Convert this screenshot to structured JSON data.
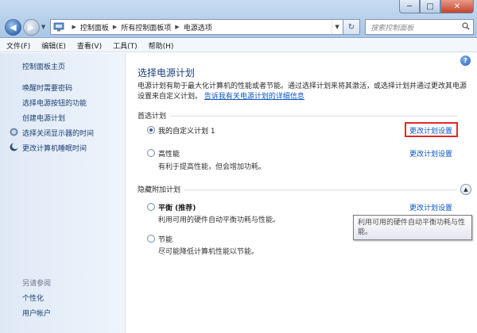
{
  "window": {
    "caption_min": "─",
    "caption_max": "□",
    "caption_close": "✕"
  },
  "address": {
    "crumbs": [
      "控制面板",
      "所有控制面板项",
      "电源选项"
    ],
    "search_placeholder": "搜索控制面板"
  },
  "menu": [
    "文件(F)",
    "编辑(E)",
    "查看(V)",
    "工具(T)",
    "帮助(H)"
  ],
  "sidebar": {
    "home": "控制面板主页",
    "links": [
      {
        "label": "唤醒时需要密码",
        "icon": ""
      },
      {
        "label": "选择电源按钮的功能",
        "icon": ""
      },
      {
        "label": "创建电源计划",
        "icon": ""
      },
      {
        "label": "选择关闭显示器的时间",
        "icon": "monitor-icon"
      },
      {
        "label": "更改计算机睡眠时间",
        "icon": "moon-icon"
      }
    ],
    "see_also": "另请参阅",
    "see_also_links": [
      "个性化",
      "用户帐户"
    ]
  },
  "main": {
    "title": "选择电源计划",
    "description": "电源计划有助于最大化计算机的性能或者节能。通过选择计划来将其激活，或选择计划并通过更改其电源设置来自定义计划。",
    "description_link": "告诉我有关电源计划的详细信息",
    "preferred_section": "首选计划",
    "hidden_section": "隐藏附加计划",
    "plans": [
      {
        "name": "我的自定义计划 1",
        "bold": "",
        "desc": "",
        "change": "更改计划设置",
        "checked": true
      },
      {
        "name": "高性能",
        "bold": "",
        "desc": "有利于提高性能，但会增加功耗。",
        "change": "更改计划设置",
        "checked": false
      },
      {
        "name": "",
        "bold": "平衡 (推荐)",
        "desc": "利用可用的硬件自动平衡功耗与性能。",
        "change": "更改计划设置",
        "checked": false
      },
      {
        "name": "节能",
        "bold": "",
        "desc": "尽可能降低计算机性能以节能。",
        "change": "",
        "checked": false
      }
    ],
    "tooltip": "利用可用的硬件自动平衡功耗与性能。"
  },
  "colors": {
    "link": "#0b55c4",
    "title": "#1a3f7c",
    "highlight_box": "#e02a2a"
  }
}
